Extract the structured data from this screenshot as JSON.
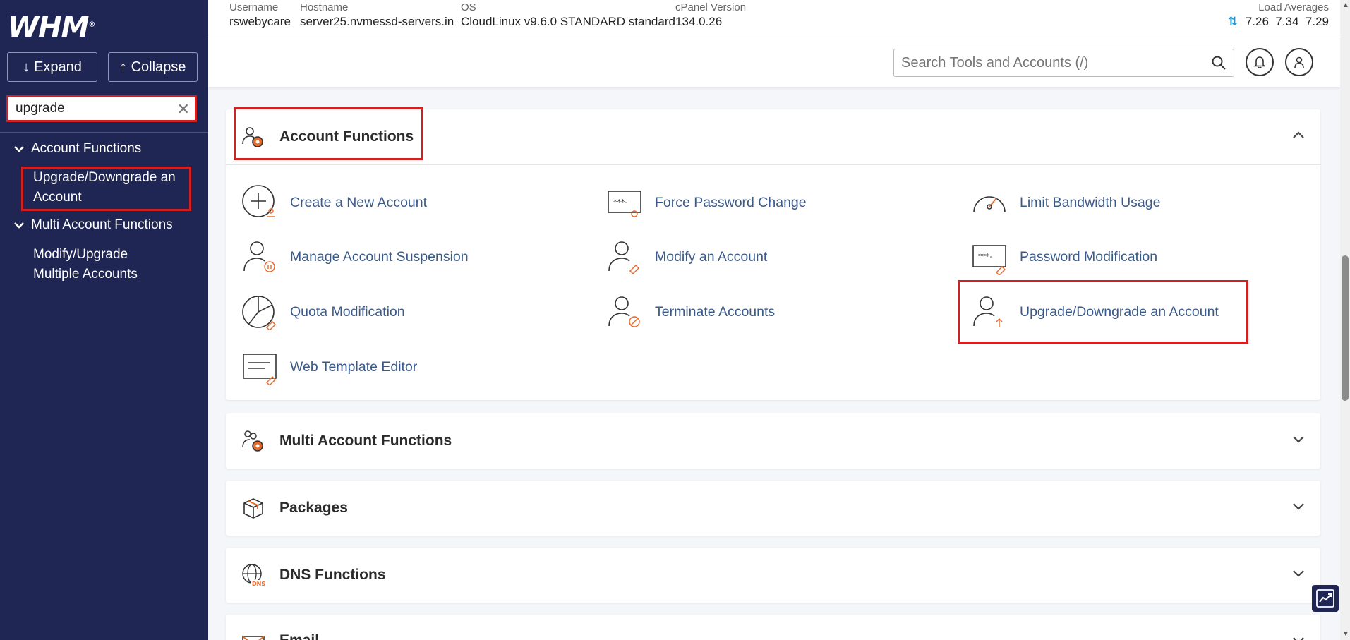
{
  "sidebar": {
    "logo": "WHM",
    "logo_mark": "®",
    "expand_label": "Expand",
    "collapse_label": "Collapse",
    "search_value": "upgrade",
    "groups": [
      {
        "label": "Account Functions",
        "items": [
          "Upgrade/Downgrade an",
          "Account"
        ]
      },
      {
        "label": "Multi Account Functions",
        "items": [
          "Modify/Upgrade",
          "Multiple Accounts"
        ]
      }
    ]
  },
  "server_info": {
    "username_label": "Username",
    "username": "rswebycare",
    "hostname_label": "Hostname",
    "hostname": "server25.nvmessd-servers.in",
    "os_label": "OS",
    "os": "CloudLinux v9.6.0 STANDARD standard",
    "cpanel_label": "cPanel Version",
    "cpanel": "134.0.26",
    "load_label": "Load Averages",
    "load_1": "7.26",
    "load_5": "7.34",
    "load_15": "7.29"
  },
  "header": {
    "search_placeholder": "Search Tools and Accounts (/)"
  },
  "panels": {
    "account_functions": {
      "title": "Account Functions",
      "tools": [
        "Create a New Account",
        "Force Password Change",
        "Limit Bandwidth Usage",
        "Manage Account Suspension",
        "Modify an Account",
        "Password Modification",
        "Quota Modification",
        "Terminate Accounts",
        "Upgrade/Downgrade an Account",
        "Web Template Editor"
      ]
    },
    "multi_account": {
      "title": "Multi Account Functions"
    },
    "packages": {
      "title": "Packages"
    },
    "dns": {
      "title": "DNS Functions"
    },
    "email": {
      "title": "Email"
    }
  },
  "colors": {
    "sidebar_bg": "#1f2654",
    "highlight_red": "#d0201f",
    "link_blue": "#3a5a8a",
    "icon_orange": "#e5692a"
  }
}
